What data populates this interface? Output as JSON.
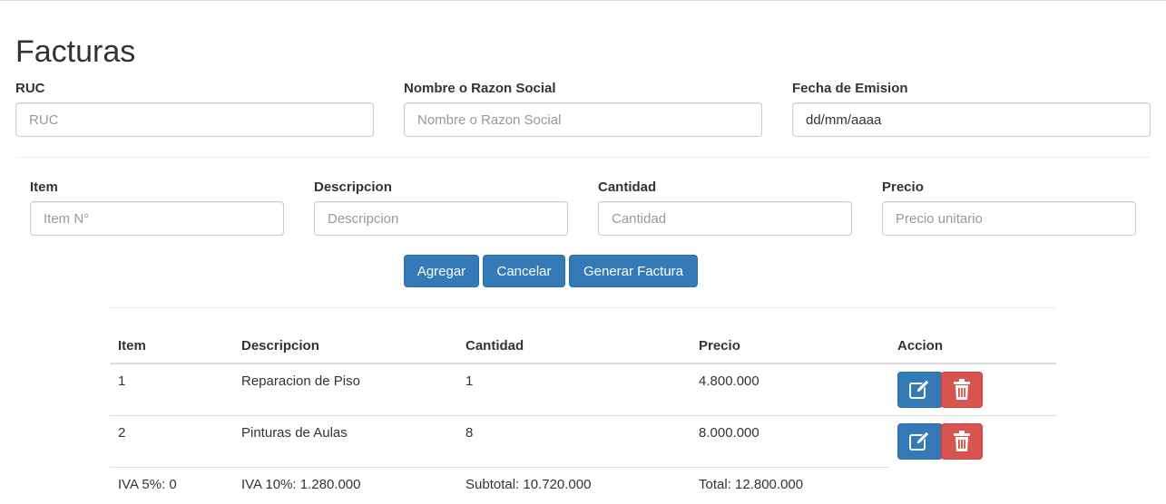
{
  "page": {
    "title": "Facturas"
  },
  "header_form": {
    "ruc": {
      "label": "RUC",
      "placeholder": "RUC"
    },
    "nombre": {
      "label": "Nombre o Razon Social",
      "placeholder": "Nombre o Razon Social"
    },
    "fecha": {
      "label": "Fecha de Emision",
      "placeholder": "dd/mm/aaaa"
    }
  },
  "item_form": {
    "item": {
      "label": "Item",
      "placeholder": "Item N°"
    },
    "descripcion": {
      "label": "Descripcion",
      "placeholder": "Descripcion"
    },
    "cantidad": {
      "label": "Cantidad",
      "placeholder": "Cantidad"
    },
    "precio": {
      "label": "Precio",
      "placeholder": "Precio unitario"
    }
  },
  "buttons": {
    "agregar": "Agregar",
    "cancelar": "Cancelar",
    "generar": "Generar Factura"
  },
  "table": {
    "headers": [
      "Item",
      "Descripcion",
      "Cantidad",
      "Precio",
      "Accion"
    ],
    "rows": [
      {
        "item": "1",
        "descripcion": "Reparacion de Piso",
        "cantidad": "1",
        "precio": "4.800.000"
      },
      {
        "item": "2",
        "descripcion": "Pinturas de Aulas",
        "cantidad": "8",
        "precio": "8.000.000"
      }
    ],
    "totals": {
      "iva5": "IVA 5%: 0",
      "iva10": "IVA 10%: 1.280.000",
      "subtotal": "Subtotal: 10.720.000",
      "total": "Total: 12.800.000"
    }
  },
  "icons": {
    "edit": "edit-icon",
    "delete": "trash-icon"
  },
  "colors": {
    "primary": "#337ab7",
    "danger": "#d9534f"
  }
}
